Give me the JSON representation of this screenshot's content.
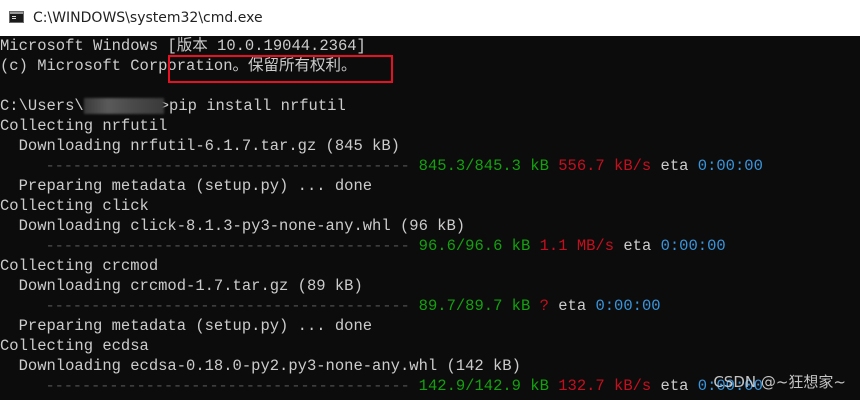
{
  "window": {
    "title": "C:\\WINDOWS\\system32\\cmd.exe",
    "icon": "cmd-icon"
  },
  "console": {
    "header1": "Microsoft Windows [版本 10.0.19044.2364]",
    "header2": "(c) Microsoft Corporation。保留所有权利。",
    "prompt_prefix": "C:\\Users\\",
    "command": ">pip install nrfutil",
    "lines": {
      "collect_nrfutil": "Collecting nrfutil",
      "dl_nrfutil": "  Downloading nrfutil-6.1.7.tar.gz (845 kB)",
      "prog1_bar": "     ---------------------------------------- ",
      "prog1_size": "845.3/845.3 kB",
      "prog1_speed": "556.7 kB/s",
      "prog1_eta_label": "eta",
      "prog1_eta": "0:00:00",
      "prep1": "  Preparing metadata (setup.py) ... done",
      "collect_click": "Collecting click",
      "dl_click": "  Downloading click-8.1.3-py3-none-any.whl (96 kB)",
      "prog2_bar": "     ---------------------------------------- ",
      "prog2_size": "96.6/96.6 kB",
      "prog2_speed": "1.1 MB/s",
      "prog2_eta_label": "eta",
      "prog2_eta": "0:00:00",
      "collect_crcmod": "Collecting crcmod",
      "dl_crcmod": "  Downloading crcmod-1.7.tar.gz (89 kB)",
      "prog3_bar": "     ---------------------------------------- ",
      "prog3_size": "89.7/89.7 kB",
      "prog3_speed": "?",
      "prog3_eta_label": "eta",
      "prog3_eta": "0:00:00",
      "prep2": "  Preparing metadata (setup.py) ... done",
      "collect_ecdsa": "Collecting ecdsa",
      "dl_ecdsa": "  Downloading ecdsa-0.18.0-py2.py3-none-any.whl (142 kB)",
      "prog4_bar": "     ---------------------------------------- ",
      "prog4_size": "142.9/142.9 kB",
      "prog4_speed": "132.7 kB/s",
      "prog4_eta_label": "eta",
      "prog4_eta": "0:00:00"
    }
  },
  "watermark": "CSDN @~狂想家~",
  "colors": {
    "background": "#0c0c0c",
    "text": "#cccccc",
    "green": "#13a10e",
    "red": "#c50f1f",
    "cyan": "#3a96dd",
    "highlight": "#e81123"
  }
}
